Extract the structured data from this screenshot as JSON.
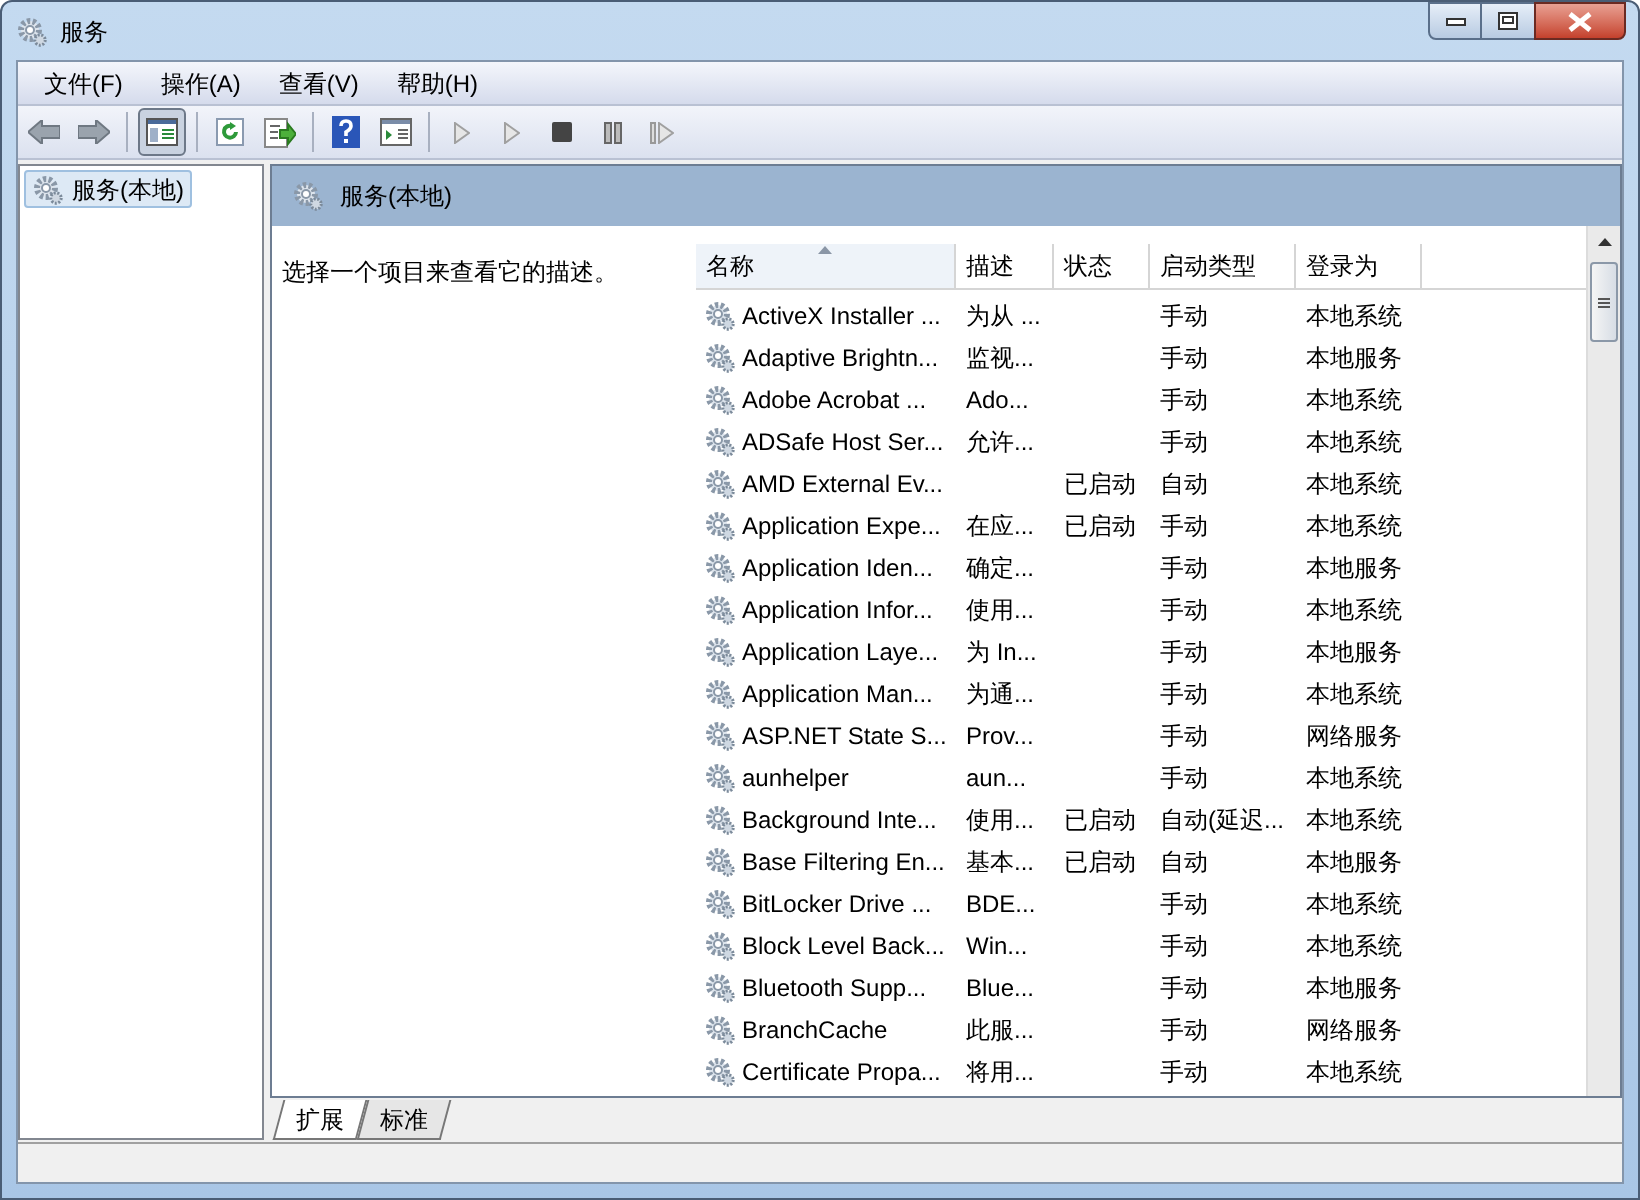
{
  "window": {
    "title": "服务"
  },
  "menu": [
    "文件(F)",
    "操作(A)",
    "查看(V)",
    "帮助(H)"
  ],
  "toolbar": {
    "console_tree_pressed": true
  },
  "tree": {
    "items": [
      {
        "label": "服务(本地)",
        "selected": true
      }
    ]
  },
  "pane": {
    "title": "服务(本地)",
    "description": "选择一个项目来查看它的描述。"
  },
  "table": {
    "columns": [
      {
        "label": "名称",
        "sorted": true
      },
      {
        "label": "描述",
        "sorted": false
      },
      {
        "label": "状态",
        "sorted": false
      },
      {
        "label": "启动类型",
        "sorted": false
      },
      {
        "label": "登录为",
        "sorted": false
      }
    ],
    "rows": [
      [
        "ActiveX Installer ...",
        "为从 ...",
        "",
        "手动",
        "本地系统"
      ],
      [
        "Adaptive Brightn...",
        "监视...",
        "",
        "手动",
        "本地服务"
      ],
      [
        "Adobe Acrobat ...",
        "Ado...",
        "",
        "手动",
        "本地系统"
      ],
      [
        "ADSafe Host Ser...",
        "允许...",
        "",
        "手动",
        "本地系统"
      ],
      [
        "AMD External Ev...",
        "",
        "已启动",
        "自动",
        "本地系统"
      ],
      [
        "Application Expe...",
        "在应...",
        "已启动",
        "手动",
        "本地系统"
      ],
      [
        "Application Iden...",
        "确定...",
        "",
        "手动",
        "本地服务"
      ],
      [
        "Application Infor...",
        "使用...",
        "",
        "手动",
        "本地系统"
      ],
      [
        "Application Laye...",
        "为 In...",
        "",
        "手动",
        "本地服务"
      ],
      [
        "Application Man...",
        "为通...",
        "",
        "手动",
        "本地系统"
      ],
      [
        "ASP.NET State S...",
        "Prov...",
        "",
        "手动",
        "网络服务"
      ],
      [
        "aunhelper",
        "aun...",
        "",
        "手动",
        "本地系统"
      ],
      [
        "Background Inte...",
        "使用...",
        "已启动",
        "自动(延迟...",
        "本地系统"
      ],
      [
        "Base Filtering En...",
        "基本...",
        "已启动",
        "自动",
        "本地服务"
      ],
      [
        "BitLocker Drive ...",
        "BDE...",
        "",
        "手动",
        "本地系统"
      ],
      [
        "Block Level Back...",
        "Win...",
        "",
        "手动",
        "本地系统"
      ],
      [
        "Bluetooth Supp...",
        "Blue...",
        "",
        "手动",
        "本地服务"
      ],
      [
        "BranchCache",
        "此服...",
        "",
        "手动",
        "网络服务"
      ],
      [
        "Certificate Propa...",
        "将用...",
        "",
        "手动",
        "本地系统"
      ]
    ]
  },
  "tabs": [
    {
      "label": "扩展",
      "selected": true
    },
    {
      "label": "标准",
      "selected": false
    }
  ]
}
